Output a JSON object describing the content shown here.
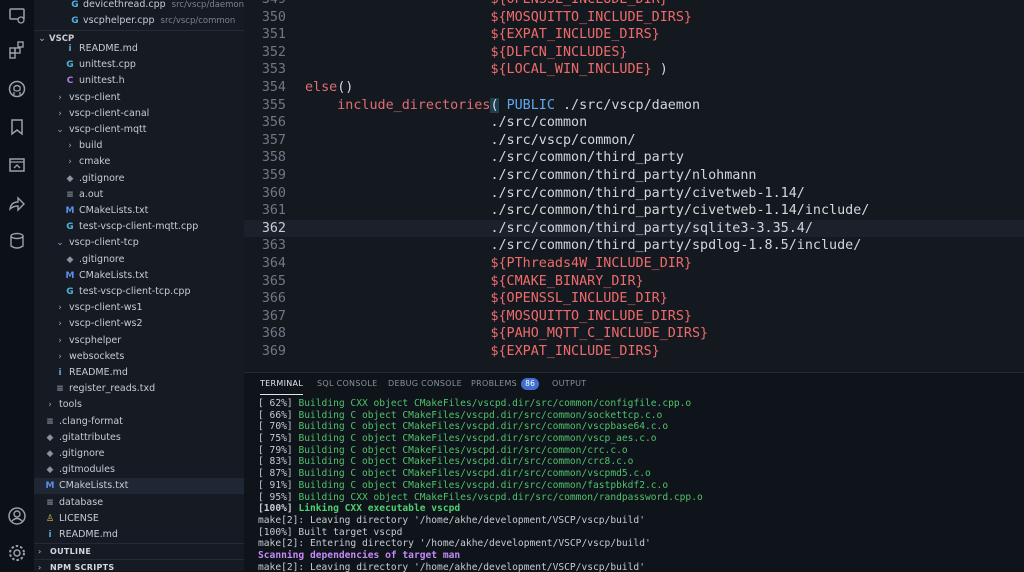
{
  "activity_bar": {
    "icons": [
      "remote-explorer-icon",
      "extensions-icon",
      "github-icon",
      "bookmarks-icon",
      "preview-icon",
      "live-share-icon",
      "database-icon",
      "account-icon",
      "settings-gear-icon"
    ]
  },
  "sidebar": {
    "open_editors": [
      {
        "label": "devicethread.cpp",
        "desc": "src/vscp/daemon",
        "icon": "G"
      },
      {
        "label": "vscphelper.cpp",
        "desc": "src/vscp/common",
        "icon": "G"
      }
    ],
    "workspace_title": "VSCP",
    "tree": [
      {
        "label": "README.md",
        "icon": "i",
        "indent": 2
      },
      {
        "label": "unittest.cpp",
        "icon": "G",
        "indent": 2
      },
      {
        "label": "unittest.h",
        "icon": "C",
        "indent": 2
      },
      {
        "label": "vscp-client",
        "chev": "›",
        "indent": 1
      },
      {
        "label": "vscp-client-canal",
        "chev": "›",
        "indent": 1
      },
      {
        "label": "vscp-client-mqtt",
        "chev": "⌄",
        "indent": 1
      },
      {
        "label": "build",
        "chev": "›",
        "indent": 2
      },
      {
        "label": "cmake",
        "chev": "›",
        "indent": 2
      },
      {
        "label": ".gitignore",
        "icon": "◆",
        "indent": 2
      },
      {
        "label": "a.out",
        "icon": "≡",
        "indent": 2
      },
      {
        "label": "CMakeLists.txt",
        "icon": "M",
        "indent": 2
      },
      {
        "label": "test-vscp-client-mqtt.cpp",
        "icon": "G",
        "indent": 2
      },
      {
        "label": "vscp-client-tcp",
        "chev": "⌄",
        "indent": 1
      },
      {
        "label": ".gitignore",
        "icon": "◆",
        "indent": 2
      },
      {
        "label": "CMakeLists.txt",
        "icon": "M",
        "indent": 2
      },
      {
        "label": "test-vscp-client-tcp.cpp",
        "icon": "G",
        "indent": 2
      },
      {
        "label": "vscp-client-ws1",
        "chev": "›",
        "indent": 1
      },
      {
        "label": "vscp-client-ws2",
        "chev": "›",
        "indent": 1
      },
      {
        "label": "vscphelper",
        "chev": "›",
        "indent": 1
      },
      {
        "label": "websockets",
        "chev": "›",
        "indent": 1
      },
      {
        "label": "README.md",
        "icon": "i",
        "indent": 1
      },
      {
        "label": "register_reads.txd",
        "icon": "≡",
        "indent": 1
      },
      {
        "label": "tools",
        "chev": "›",
        "indent": 0
      },
      {
        "label": ".clang-format",
        "icon": "≡",
        "indent": 0
      },
      {
        "label": ".gitattributes",
        "icon": "◆",
        "indent": 0
      },
      {
        "label": ".gitignore",
        "icon": "◆",
        "indent": 0
      },
      {
        "label": ".gitmodules",
        "icon": "◆",
        "indent": 0
      },
      {
        "label": "CMakeLists.txt",
        "icon": "M",
        "indent": 0,
        "active": true
      },
      {
        "label": "database",
        "icon": "≡",
        "indent": 0
      },
      {
        "label": "LICENSE",
        "icon": "♙",
        "indent": 0
      },
      {
        "label": "README.md",
        "icon": "i",
        "indent": 0
      }
    ],
    "sections": [
      "OUTLINE",
      "NPM SCRIPTS"
    ]
  },
  "editor": {
    "current_line": 362,
    "lines": [
      {
        "n": "349",
        "indent": "                       ",
        "parts": [
          [
            "var",
            "${OPENSSL_INCLUDE_DIR}"
          ]
        ]
      },
      {
        "n": "350",
        "indent": "                       ",
        "parts": [
          [
            "var",
            "${MOSQUITTO_INCLUDE_DIRS}"
          ]
        ]
      },
      {
        "n": "351",
        "indent": "                       ",
        "parts": [
          [
            "var",
            "${EXPAT_INCLUDE_DIRS}"
          ]
        ]
      },
      {
        "n": "352",
        "indent": "                       ",
        "parts": [
          [
            "var",
            "${DLFCN_INCLUDES}"
          ]
        ]
      },
      {
        "n": "353",
        "indent": "                       ",
        "parts": [
          [
            "var",
            "${LOCAL_WIN_INCLUDE}"
          ],
          [
            "plain",
            " )"
          ]
        ]
      },
      {
        "n": "354",
        "indent": "",
        "parts": [
          [
            "kw",
            "else"
          ],
          [
            "plain",
            "()"
          ]
        ]
      },
      {
        "n": "355",
        "indent": "    ",
        "parts": [
          [
            "fn",
            "include_directories"
          ],
          [
            "paren",
            "("
          ],
          [
            "plain",
            " "
          ],
          [
            "pub",
            "PUBLIC"
          ],
          [
            "plain",
            " ./src/vscp/daemon"
          ]
        ]
      },
      {
        "n": "356",
        "indent": "                       ",
        "parts": [
          [
            "plain",
            "./src/common"
          ]
        ]
      },
      {
        "n": "357",
        "indent": "                       ",
        "parts": [
          [
            "plain",
            "./src/vscp/common/"
          ]
        ]
      },
      {
        "n": "358",
        "indent": "                       ",
        "parts": [
          [
            "plain",
            "./src/common/third_party"
          ]
        ]
      },
      {
        "n": "359",
        "indent": "                       ",
        "parts": [
          [
            "plain",
            "./src/common/third_party/nlohmann"
          ]
        ]
      },
      {
        "n": "360",
        "indent": "                       ",
        "parts": [
          [
            "plain",
            "./src/common/third_party/civetweb-1.14/"
          ]
        ]
      },
      {
        "n": "361",
        "indent": "                       ",
        "parts": [
          [
            "plain",
            "./src/common/third_party/civetweb-1.14/include/"
          ]
        ]
      },
      {
        "n": "362",
        "indent": "                       ",
        "parts": [
          [
            "plain",
            "./src/common/third_party/sqlite3-3.35.4/"
          ]
        ]
      },
      {
        "n": "363",
        "indent": "                       ",
        "parts": [
          [
            "plain",
            "./src/common/third_party/spdlog-1.8.5/include/"
          ]
        ]
      },
      {
        "n": "364",
        "indent": "                       ",
        "parts": [
          [
            "var",
            "${PThreads4W_INCLUDE_DIR}"
          ]
        ]
      },
      {
        "n": "365",
        "indent": "                       ",
        "parts": [
          [
            "var",
            "${CMAKE_BINARY_DIR}"
          ]
        ]
      },
      {
        "n": "366",
        "indent": "                       ",
        "parts": [
          [
            "var",
            "${OPENSSL_INCLUDE_DIR}"
          ]
        ]
      },
      {
        "n": "367",
        "indent": "                       ",
        "parts": [
          [
            "var",
            "${MOSQUITTO_INCLUDE_DIRS}"
          ]
        ]
      },
      {
        "n": "368",
        "indent": "                       ",
        "parts": [
          [
            "var",
            "${PAHO_MQTT_C_INCLUDE_DIRS}"
          ]
        ]
      },
      {
        "n": "369",
        "indent": "                       ",
        "parts": [
          [
            "var",
            "${EXPAT_INCLUDE_DIRS}"
          ]
        ]
      }
    ]
  },
  "panel": {
    "tabs": [
      {
        "label": "TERMINAL",
        "active": true
      },
      {
        "label": "SQL CONSOLE"
      },
      {
        "label": "DEBUG CONSOLE"
      },
      {
        "label": "PROBLEMS",
        "badge": "86"
      },
      {
        "label": "OUTPUT"
      }
    ],
    "terminal_lines": [
      {
        "style": "green",
        "pct": "[ 62%] ",
        "text": "Building CXX object CMakeFiles/vscpd.dir/src/common/configfile.cpp.o"
      },
      {
        "style": "green",
        "pct": "[ 66%] ",
        "text": "Building C object CMakeFiles/vscpd.dir/src/common/sockettcp.c.o"
      },
      {
        "style": "green",
        "pct": "[ 70%] ",
        "text": "Building C object CMakeFiles/vscpd.dir/src/common/vscpbase64.c.o"
      },
      {
        "style": "green",
        "pct": "[ 75%] ",
        "text": "Building C object CMakeFiles/vscpd.dir/src/common/vscp_aes.c.o"
      },
      {
        "style": "green",
        "pct": "[ 79%] ",
        "text": "Building C object CMakeFiles/vscpd.dir/src/common/crc.c.o"
      },
      {
        "style": "green",
        "pct": "[ 83%] ",
        "text": "Building C object CMakeFiles/vscpd.dir/src/common/crc8.c.o"
      },
      {
        "style": "green",
        "pct": "[ 87%] ",
        "text": "Building C object CMakeFiles/vscpd.dir/src/common/vscpmd5.c.o"
      },
      {
        "style": "green",
        "pct": "[ 91%] ",
        "text": "Building C object CMakeFiles/vscpd.dir/src/common/fastpbkdf2.c.o"
      },
      {
        "style": "green",
        "pct": "[ 95%] ",
        "text": "Building CXX object CMakeFiles/vscpd.dir/src/common/randpassword.cpp.o"
      },
      {
        "style": "boldg",
        "pct": "[100%] ",
        "text": "Linking CXX executable vscpd"
      },
      {
        "style": "plain",
        "pct": "",
        "text": "make[2]: Leaving directory '/home/akhe/development/VSCP/vscp/build'"
      },
      {
        "style": "plain",
        "pct": "",
        "text": "[100%] Built target vscpd"
      },
      {
        "style": "plain",
        "pct": "",
        "text": "make[2]: Entering directory '/home/akhe/development/VSCP/vscp/build'"
      },
      {
        "style": "purple",
        "pct": "",
        "text": "Scanning dependencies of target man"
      },
      {
        "style": "plain",
        "pct": "",
        "text": "make[2]: Leaving directory '/home/akhe/development/VSCP/vscp/build'"
      }
    ]
  }
}
